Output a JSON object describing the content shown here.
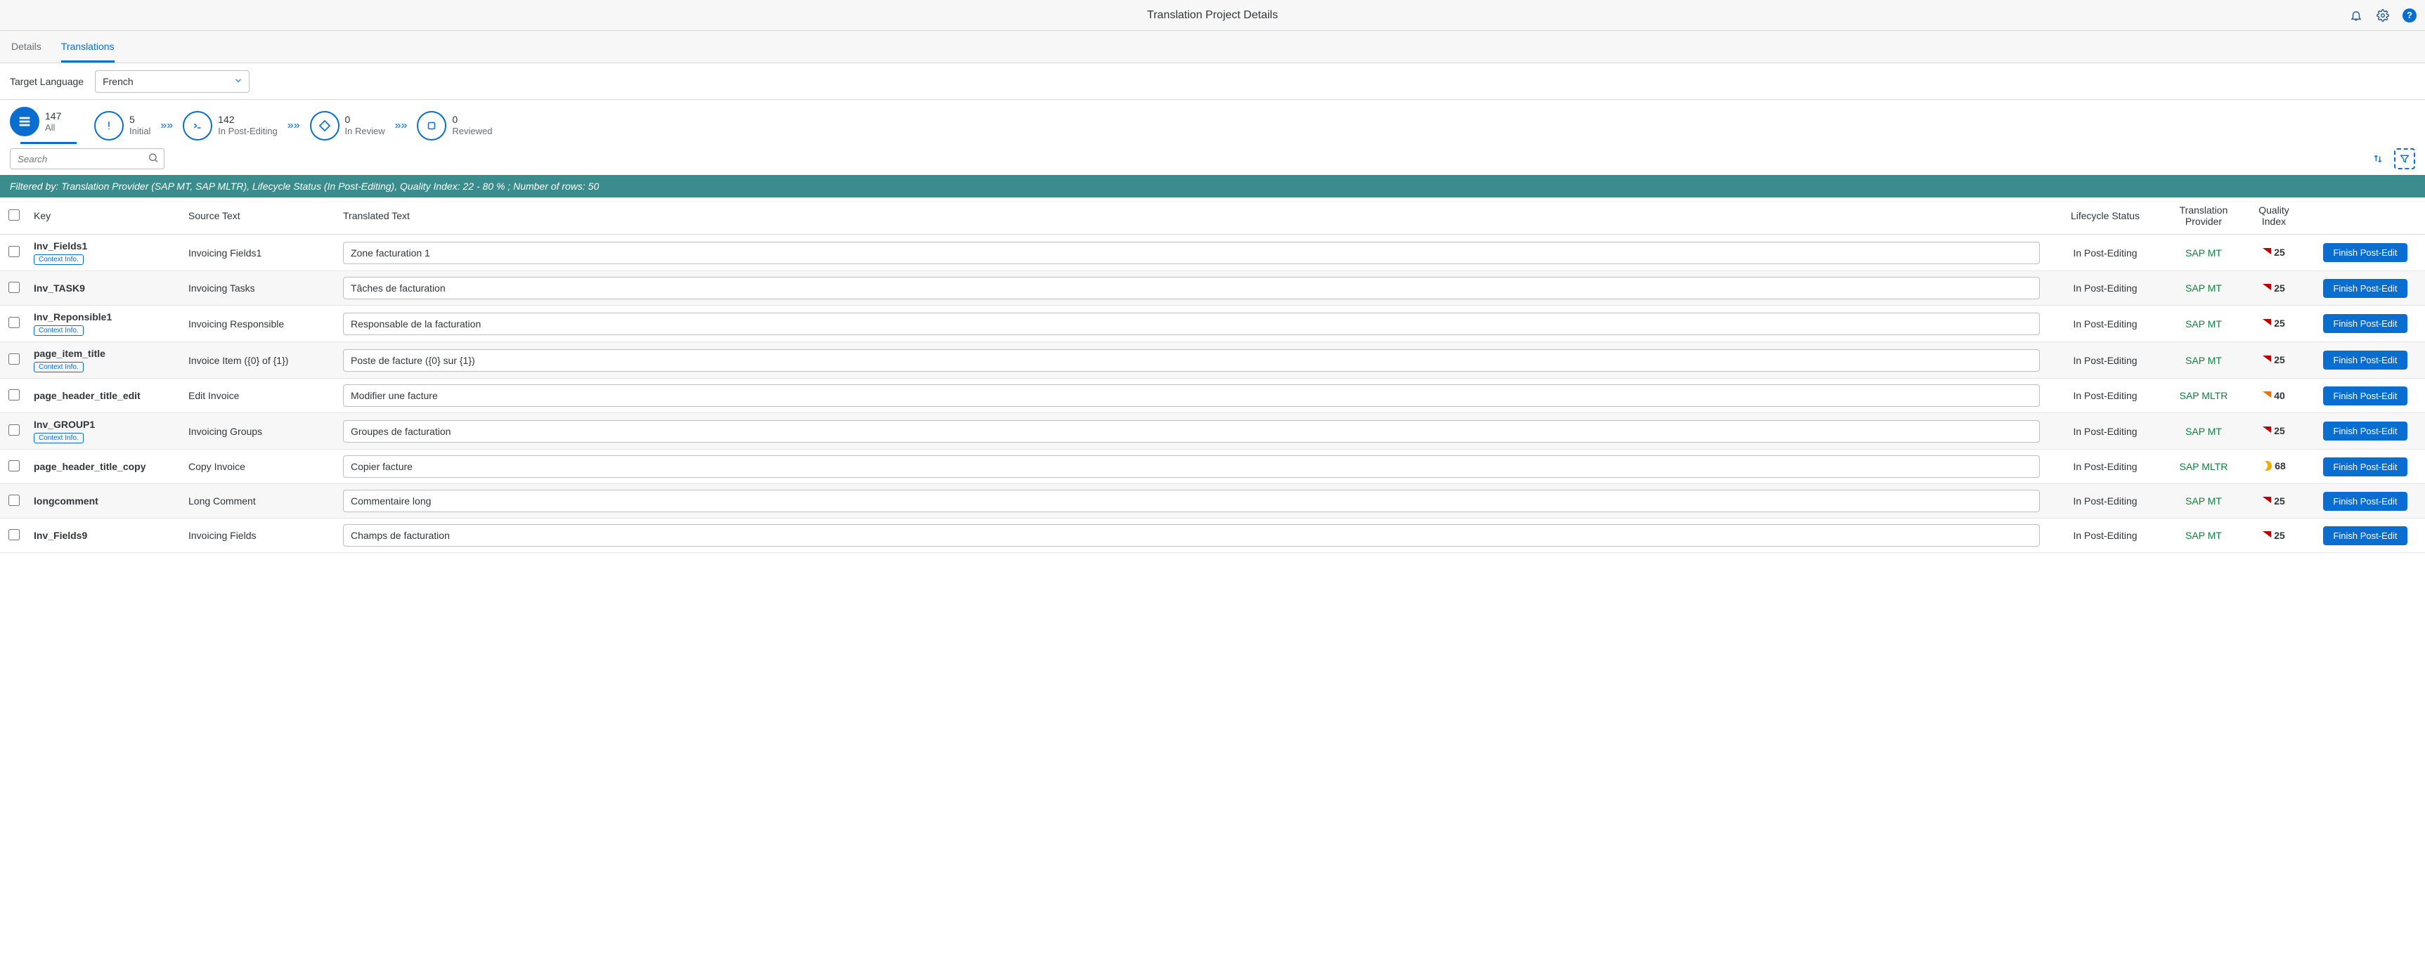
{
  "header": {
    "title": "Translation Project Details"
  },
  "tabs": {
    "details": "Details",
    "translations": "Translations",
    "active": "translations"
  },
  "target_language": {
    "label": "Target Language",
    "value": "French"
  },
  "status": {
    "all": {
      "count": "147",
      "label": "All"
    },
    "initial": {
      "count": "5",
      "label": "Initial"
    },
    "post_editing": {
      "count": "142",
      "label": "In Post-Editing"
    },
    "in_review": {
      "count": "0",
      "label": "In Review"
    },
    "reviewed": {
      "count": "0",
      "label": "Reviewed"
    }
  },
  "search": {
    "placeholder": "Search"
  },
  "filter_bar": "Filtered by: Translation Provider (SAP MT, SAP MLTR), Lifecycle Status (In Post-Editing), Quality Index: 22 - 80 % ; Number of rows: 50",
  "columns": {
    "key": "Key",
    "source": "Source Text",
    "translated": "Translated Text",
    "lifecycle": "Lifecycle Status",
    "provider": "Translation Provider",
    "qi": "Quality Index"
  },
  "context_label": "Context Info.",
  "action_label": "Finish Post-Edit",
  "rows": [
    {
      "key": "Inv_Fields1",
      "has_ctx": true,
      "source": "Invoicing Fields1",
      "translated": "Zone facturation 1",
      "lifecycle": "In Post-Editing",
      "provider": "SAP MT",
      "qi": "25",
      "qi_level": "red"
    },
    {
      "key": "Inv_TASK9",
      "has_ctx": false,
      "source": "Invoicing Tasks",
      "translated": "Tâches de facturation",
      "lifecycle": "In Post-Editing",
      "provider": "SAP MT",
      "qi": "25",
      "qi_level": "red"
    },
    {
      "key": "Inv_Reponsible1",
      "has_ctx": true,
      "source": "Invoicing Responsible",
      "translated": "Responsable de la facturation",
      "lifecycle": "In Post-Editing",
      "provider": "SAP MT",
      "qi": "25",
      "qi_level": "red"
    },
    {
      "key": "page_item_title",
      "has_ctx": true,
      "source": "Invoice Item ({0} of {1})",
      "translated": "Poste de facture ({0} sur {1})",
      "lifecycle": "In Post-Editing",
      "provider": "SAP MT",
      "qi": "25",
      "qi_level": "red"
    },
    {
      "key": "page_header_title_edit",
      "has_ctx": false,
      "source": "Edit Invoice",
      "translated": "Modifier une facture",
      "lifecycle": "In Post-Editing",
      "provider": "SAP MLTR",
      "qi": "40",
      "qi_level": "orange"
    },
    {
      "key": "Inv_GROUP1",
      "has_ctx": true,
      "source": "Invoicing Groups",
      "translated": "Groupes de facturation",
      "lifecycle": "In Post-Editing",
      "provider": "SAP MT",
      "qi": "25",
      "qi_level": "red"
    },
    {
      "key": "page_header_title_copy",
      "has_ctx": false,
      "source": "Copy Invoice",
      "translated": "Copier facture",
      "lifecycle": "In Post-Editing",
      "provider": "SAP MLTR",
      "qi": "68",
      "qi_level": "moon"
    },
    {
      "key": "longcomment",
      "has_ctx": false,
      "source": "Long Comment",
      "translated": "Commentaire long",
      "lifecycle": "In Post-Editing",
      "provider": "SAP MT",
      "qi": "25",
      "qi_level": "red"
    },
    {
      "key": "Inv_Fields9",
      "has_ctx": false,
      "source": "Invoicing Fields",
      "translated": "Champs de facturation",
      "lifecycle": "In Post-Editing",
      "provider": "SAP MT",
      "qi": "25",
      "qi_level": "red"
    }
  ]
}
